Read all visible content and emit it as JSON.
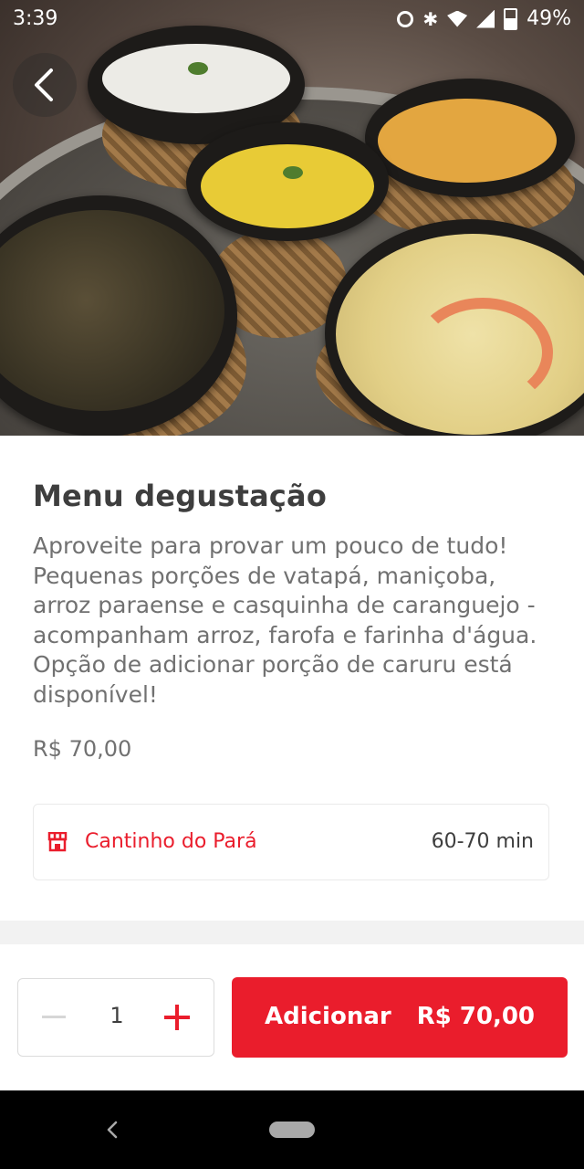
{
  "status_bar": {
    "time": "3:39",
    "battery": "49%"
  },
  "hero": {
    "image_alt": "tasting menu dishes"
  },
  "item": {
    "title": "Menu degustação",
    "description": "Aproveite para provar um pouco de tudo! Pequenas porções de vatapá, maniçoba, arroz paraense e casquinha de caranguejo - acompanham arroz, farofa e farinha d'água. Opção de adicionar porção de caruru está disponível!",
    "price": "R$ 70,00"
  },
  "store": {
    "name": "Cantinho do Pará",
    "delivery_time": "60-70 min",
    "icon": "store-icon"
  },
  "order": {
    "quantity": "1",
    "add_label": "Adicionar",
    "total": "R$ 70,00"
  },
  "colors": {
    "accent": "#ea1d2c",
    "text_primary": "#3e3e3e",
    "text_secondary": "#717171"
  }
}
